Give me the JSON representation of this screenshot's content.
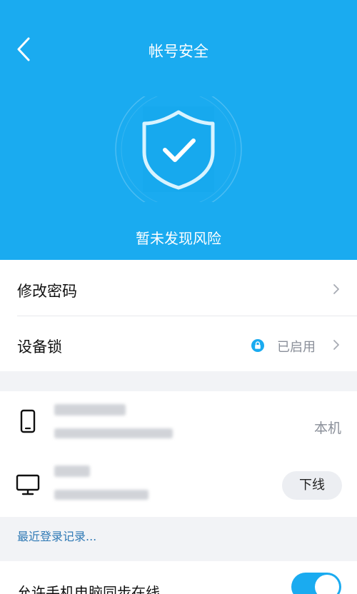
{
  "header": {
    "title": "帐号安全",
    "status": "暂未发现风险"
  },
  "security": {
    "change_password": "修改密码",
    "device_lock": {
      "label": "设备锁",
      "status": "已启用"
    }
  },
  "devices": [
    {
      "type": "phone-icon",
      "badge": "本机"
    },
    {
      "type": "desktop-icon",
      "action": "下线"
    }
  ],
  "recent_logins_link": "最近登录记录...",
  "sync_online": {
    "label": "允许手机电脑同步在线",
    "enabled": true
  },
  "colors": {
    "primary": "#1aabf0",
    "link": "#2f79b5",
    "muted": "#8a8f99"
  }
}
